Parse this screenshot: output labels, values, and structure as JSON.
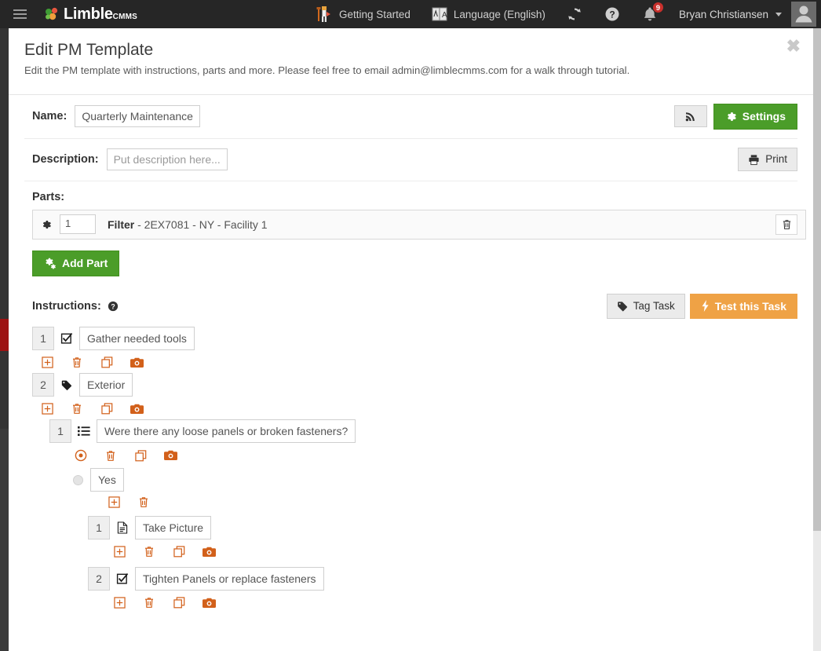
{
  "topbar": {
    "menu_icon": "hamburger-icon",
    "brand": "Limble",
    "brand_sub": "CMMS",
    "items": [
      {
        "icon": "getting-started-icon",
        "label": "Getting Started"
      },
      {
        "icon": "language-icon",
        "label": "Language (English)"
      }
    ],
    "refresh_icon": "refresh-icon",
    "help_icon": "help-circle-icon",
    "bell_icon": "bell-icon",
    "notification_count": "9",
    "user_name": "Bryan Christiansen",
    "avatar_icon": "user-avatar-icon",
    "badge_color": "#c9302c"
  },
  "modal": {
    "title": "Edit PM Template",
    "subtitle": "Edit the PM template with instructions, parts and more. Please feel free to email admin@limblecmms.com for a walk through tutorial.",
    "close_label": "✖"
  },
  "name_row": {
    "label": "Name:",
    "value": "Quarterly Maintenance",
    "rss_button": {
      "icon": "rss-icon",
      "label": ""
    },
    "settings_button": {
      "icon": "gear-icon",
      "label": "Settings"
    }
  },
  "description_row": {
    "label": "Description:",
    "placeholder": "Put description here...",
    "value": "Put description here...",
    "print_button": {
      "icon": "printer-icon",
      "label": "Print"
    }
  },
  "parts": {
    "label": "Parts:",
    "rows": [
      {
        "gear_icon": "gear-icon",
        "quantity": "1",
        "name": "Filter",
        "detail": " - 2EX7081 - NY - Facility 1",
        "delete_icon": "trash-icon"
      }
    ],
    "add_button": {
      "icon": "gears-icon",
      "label": "Add Part"
    }
  },
  "instructions": {
    "label": "Instructions:",
    "help_icon": "help-circle-icon",
    "tag_button": {
      "icon": "tag-icon",
      "label": "Tag Task"
    },
    "test_button": {
      "icon": "bolt-icon",
      "label": "Test this Task"
    },
    "items": [
      {
        "number": "1",
        "type_icon": "checkbox-checked-icon",
        "text": "Gather needed tools",
        "actions": [
          "plus-square-icon",
          "trash-icon",
          "copy-icon",
          "camera-icon"
        ]
      },
      {
        "number": "2",
        "type_icon": "tag-icon",
        "text": "Exterior",
        "actions": [
          "plus-square-icon",
          "trash-icon",
          "copy-icon",
          "camera-icon"
        ],
        "children": [
          {
            "number": "1",
            "type_icon": "list-icon",
            "text": "Were there any loose panels or broken fasteners?",
            "actions": [
              "dot-circle-icon",
              "trash-icon",
              "copy-icon",
              "camera-icon"
            ],
            "option": {
              "radio_icon": "radio-unchecked-icon",
              "text": "Yes",
              "actions": [
                "plus-square-icon",
                "trash-icon"
              ],
              "children": [
                {
                  "number": "1",
                  "type_icon": "file-icon",
                  "text": "Take Picture",
                  "actions": [
                    "plus-square-icon",
                    "trash-icon",
                    "copy-icon",
                    "camera-icon"
                  ]
                },
                {
                  "number": "2",
                  "type_icon": "checkbox-checked-icon",
                  "text": "Tighten Panels or replace fasteners",
                  "actions": [
                    "plus-square-icon",
                    "trash-icon",
                    "copy-icon",
                    "camera-icon"
                  ]
                }
              ]
            }
          }
        ]
      }
    ]
  },
  "colors": {
    "green": "#4b9d29",
    "orange": "#efa245",
    "action_orange": "#d2601a",
    "badge_red": "#c9302c",
    "rail_red": "#9d1313",
    "topbar_dark": "#262626"
  }
}
